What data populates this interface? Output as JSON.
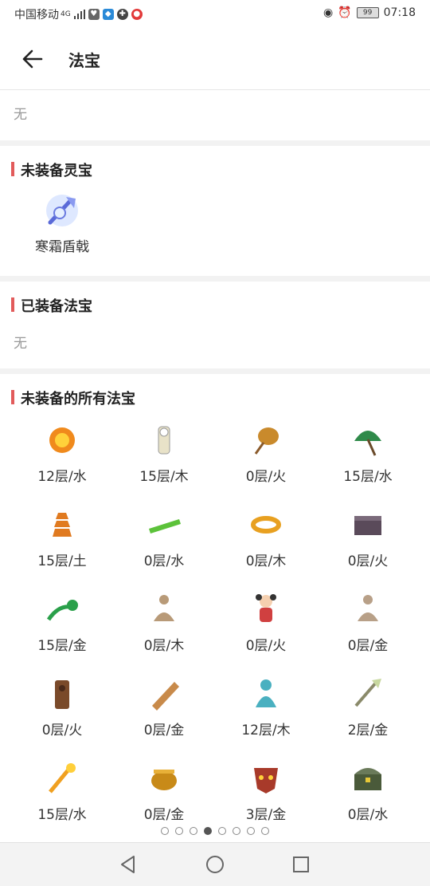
{
  "status": {
    "carrier": "中国移动",
    "network": "4G",
    "battery": "99",
    "time": "07:18"
  },
  "header": {
    "title": "法宝"
  },
  "top_section": {
    "empty": "无"
  },
  "unequipped_spirit": {
    "title": "未装备灵宝",
    "items": [
      {
        "label": "寒霜盾戟",
        "icon": "frost-shield-halberd-icon"
      }
    ]
  },
  "equipped": {
    "title": "已装备法宝",
    "empty": "无"
  },
  "all_unequipped": {
    "title": "未装备的所有法宝",
    "items": [
      {
        "label": "12层/水",
        "icon": "fire-orb-icon",
        "color": "#f08a1c"
      },
      {
        "label": "15层/木",
        "icon": "paper-doll-icon",
        "color": "#e8e2c8"
      },
      {
        "label": "0层/火",
        "icon": "feather-fan-icon",
        "color": "#c98a2c"
      },
      {
        "label": "15层/水",
        "icon": "green-umbrella-icon",
        "color": "#2f8a4a"
      },
      {
        "label": "15层/土",
        "icon": "pagoda-icon",
        "color": "#e07a20"
      },
      {
        "label": "0层/水",
        "icon": "jade-ruler-icon",
        "color": "#5cc23a"
      },
      {
        "label": "0层/木",
        "icon": "golden-rope-icon",
        "color": "#e8a020"
      },
      {
        "label": "0层/火",
        "icon": "treasure-box-icon",
        "color": "#5a4a5a"
      },
      {
        "label": "15层/金",
        "icon": "jade-ruyi-icon",
        "color": "#2aa04a"
      },
      {
        "label": "0层/木",
        "icon": "meditating-figure-icon",
        "color": "#b89a78"
      },
      {
        "label": "0层/火",
        "icon": "doll-girl-icon",
        "color": "#d04040"
      },
      {
        "label": "0层/金",
        "icon": "meditating-figure-icon",
        "color": "#b8a088"
      },
      {
        "label": "0层/火",
        "icon": "wooden-totem-icon",
        "color": "#7a4a2a"
      },
      {
        "label": "0层/金",
        "icon": "bamboo-scroll-icon",
        "color": "#c88a4a"
      },
      {
        "label": "12层/木",
        "icon": "cyan-spirit-icon",
        "color": "#4ab0c0"
      },
      {
        "label": "2层/金",
        "icon": "writing-brush-icon",
        "color": "#8a8a6a"
      },
      {
        "label": "15层/水",
        "icon": "flame-sword-icon",
        "color": "#f0a020"
      },
      {
        "label": "0层/金",
        "icon": "golden-cauldron-icon",
        "color": "#c88a18"
      },
      {
        "label": "3层/金",
        "icon": "demon-mask-icon",
        "color": "#a83a2a"
      },
      {
        "label": "0层/水",
        "icon": "treasure-chest-icon",
        "color": "#4a5a3a"
      }
    ]
  },
  "pager": {
    "count": 8,
    "active": 3
  },
  "navbar": {
    "back": "back-triangle-icon",
    "home": "home-circle-icon",
    "recent": "recent-square-icon"
  }
}
